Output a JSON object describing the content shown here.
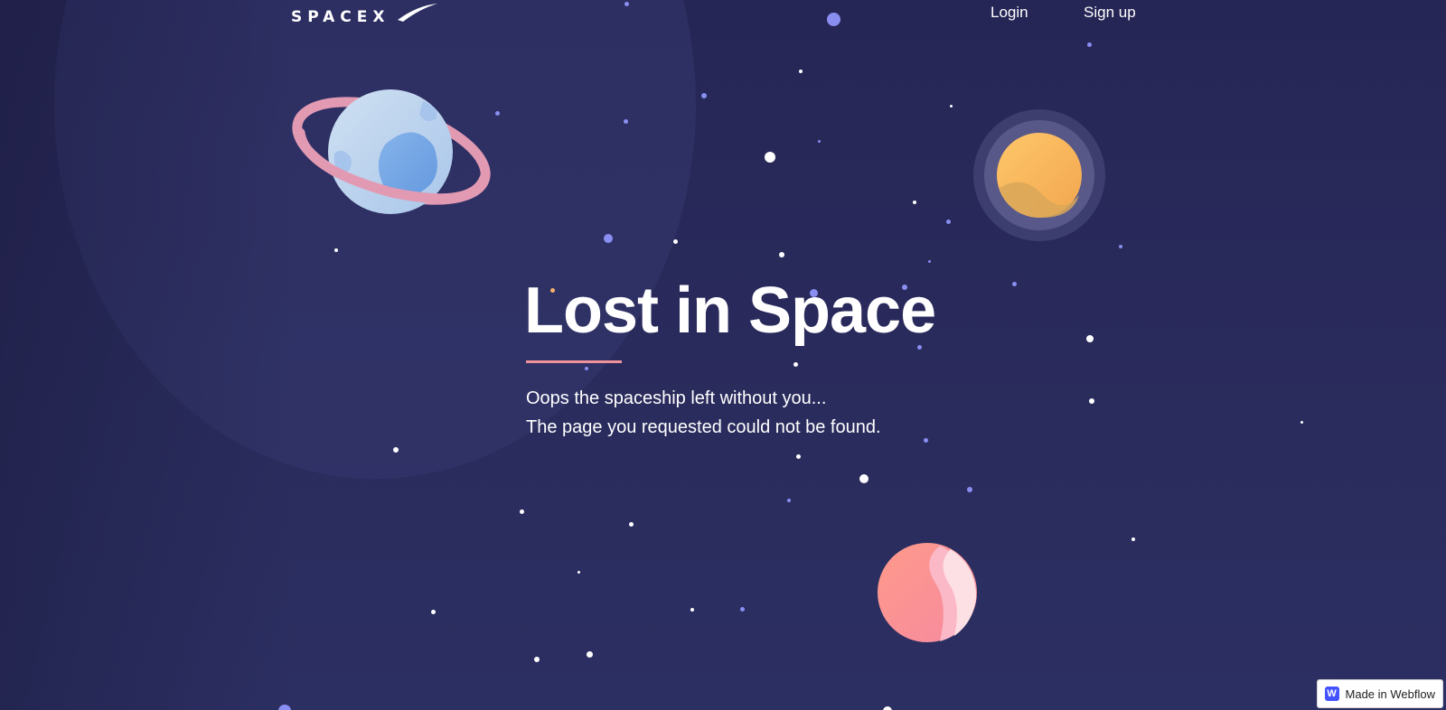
{
  "header": {
    "logo_text": "SPACEX",
    "nav": [
      {
        "label": "Login"
      },
      {
        "label": "Sign up"
      }
    ]
  },
  "main": {
    "title": "Lost in Space",
    "message_line1": "Oops the spaceship left without you...",
    "message_line2": "The page you requested could not be found."
  },
  "badge": {
    "logo_letter": "W",
    "label": "Made in Webflow"
  },
  "colors": {
    "background": "#262656",
    "accent_underline": "#f0929a",
    "star_white": "#ffffff",
    "star_blue": "#8a8ef0",
    "webflow_blue": "#4353ff"
  },
  "icons": [
    "spacex-logo",
    "ringed-planet",
    "sun-planet",
    "pink-planet",
    "webflow-logo-icon"
  ]
}
